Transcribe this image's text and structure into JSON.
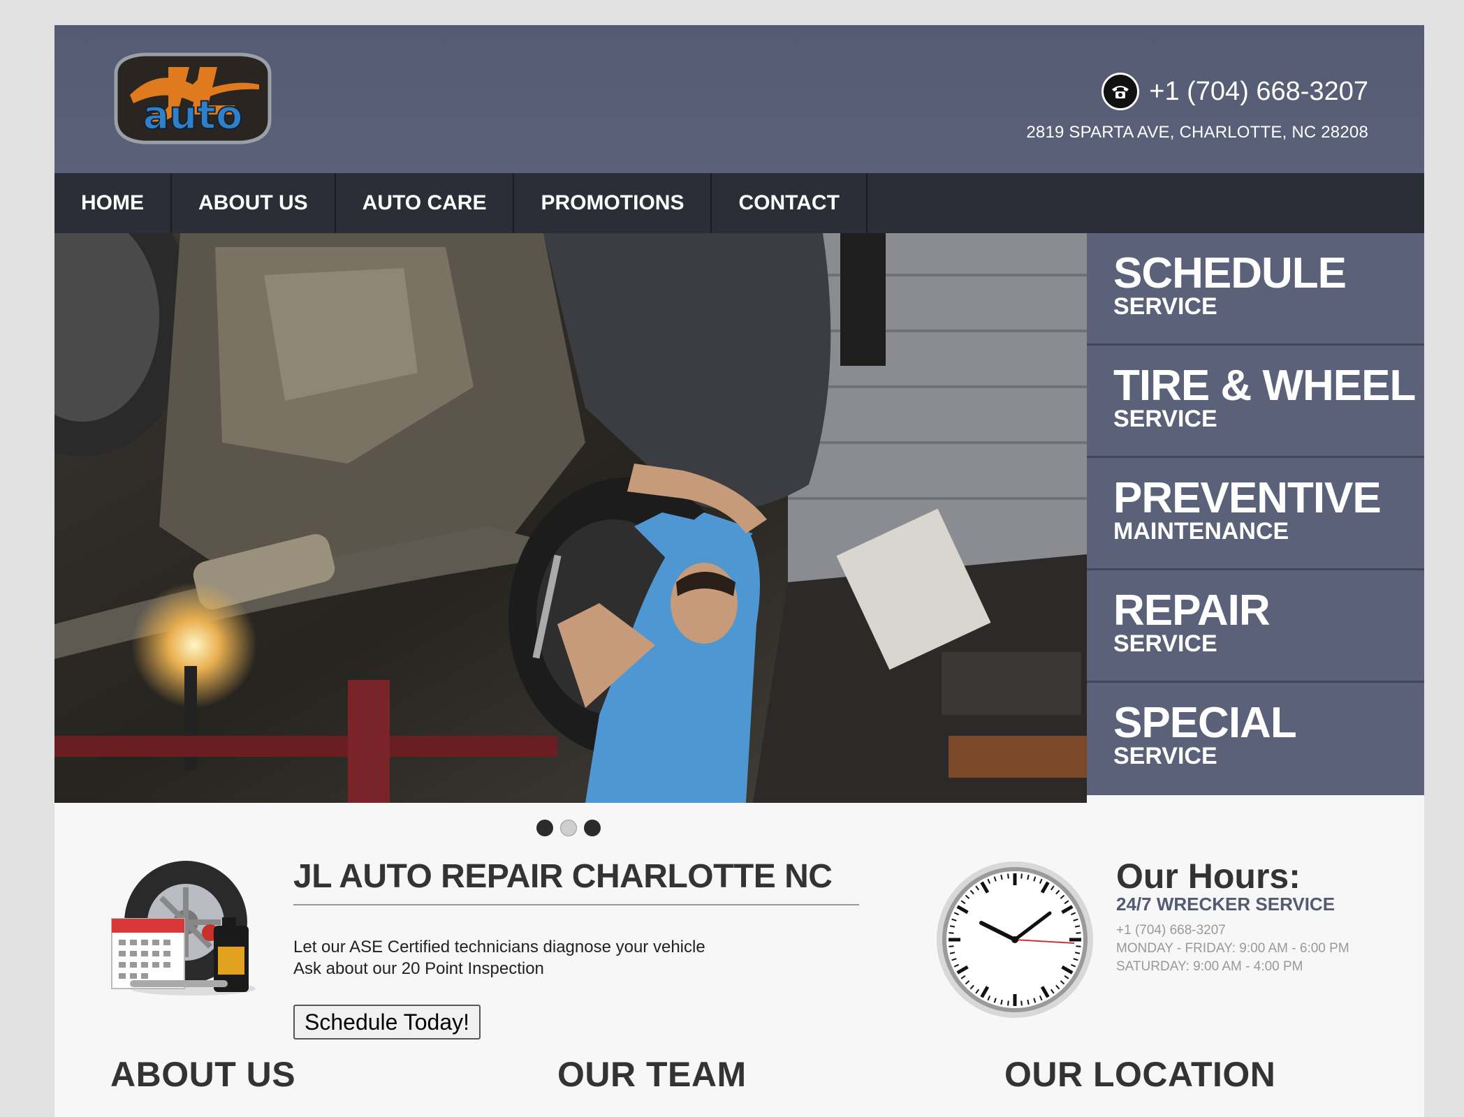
{
  "header": {
    "logo_text": "JL auto",
    "phone": "+1 (704) 668-3207",
    "address": "2819 SPARTA AVE, CHARLOTTE, NC 28208"
  },
  "nav": {
    "items": [
      {
        "label": "HOME"
      },
      {
        "label": "ABOUT US"
      },
      {
        "label": "AUTO CARE"
      },
      {
        "label": "PROMOTIONS"
      },
      {
        "label": "CONTACT"
      }
    ]
  },
  "services": [
    {
      "title": "SCHEDULE",
      "subtitle": "SERVICE"
    },
    {
      "title": "TIRE & WHEEL",
      "subtitle": "SERVICE"
    },
    {
      "title": "PREVENTIVE",
      "subtitle": "MAINTENANCE"
    },
    {
      "title": "REPAIR",
      "subtitle": "SERVICE"
    },
    {
      "title": "SPECIAL",
      "subtitle": "SERVICE"
    }
  ],
  "slider": {
    "count": 3,
    "active_index": 1
  },
  "intro": {
    "title": "JL AUTO REPAIR CHARLOTTE NC",
    "line1": "Let our ASE Certified technicians diagnose your vehicle",
    "line2": "Ask about our 20 Point Inspection",
    "button": "Schedule Today!"
  },
  "hours": {
    "title": "Our Hours:",
    "subtitle": "24/7 WRECKER SERVICE",
    "phone": "+1 (704) 668-3207",
    "weekday": "MONDAY - FRIDAY: 9:00 AM - 6:00 PM",
    "saturday": "SATURDAY: 9:00 AM - 4:00 PM"
  },
  "sections": {
    "about": "ABOUT US",
    "team": "OUR TEAM",
    "location": "OUR LOCATION"
  },
  "colors": {
    "header_bg": "#575e75",
    "nav_bg": "#2b2e36",
    "service_bg": "#5a6178",
    "accent_orange": "#e07a1f",
    "accent_blue": "#2f7fc9"
  }
}
